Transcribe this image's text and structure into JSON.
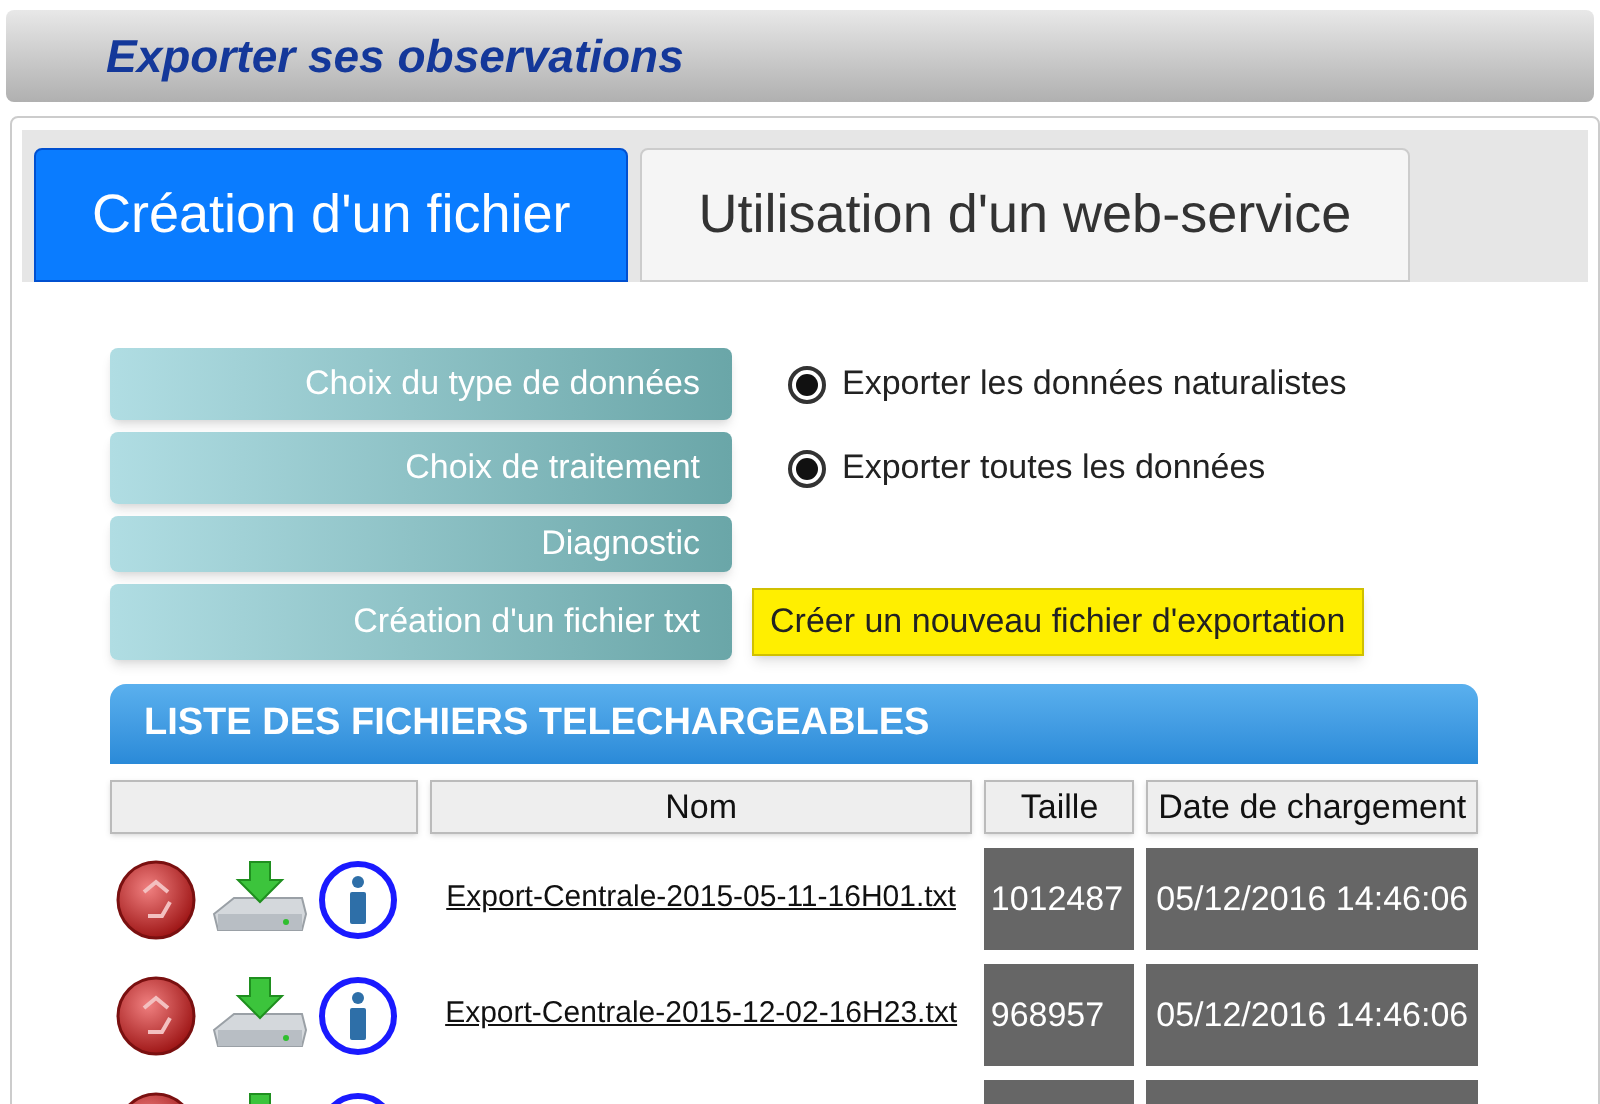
{
  "header": {
    "title": "Exporter ses observations"
  },
  "tabs": [
    {
      "label": "Création d'un fichier",
      "selected": true
    },
    {
      "label": "Utilisation d'un web-service",
      "selected": false
    }
  ],
  "steps": [
    {
      "label": "Choix du type de données",
      "kind": "radio",
      "option": "Exporter les données naturalistes",
      "checked": true
    },
    {
      "label": "Choix de traitement",
      "kind": "radio",
      "option": "Exporter toutes les données",
      "checked": true
    },
    {
      "label": "Diagnostic",
      "kind": "empty"
    },
    {
      "label": "Création d'un fichier txt",
      "kind": "button",
      "option": "Créer un nouveau fichier d'exportation"
    }
  ],
  "files": {
    "title": "LISTE DES FICHIERS TELECHARGEABLES",
    "columns": [
      "Nom",
      "Taille",
      "Date de chargement"
    ],
    "rows": [
      {
        "kind": "full",
        "name": "Export-Centrale-2015-05-11-16H01.txt",
        "size": "1012487",
        "date": "05/12/2016 14:46:06"
      },
      {
        "kind": "full",
        "name": "Export-Centrale-2015-12-02-16H23.txt",
        "size": "968957",
        "date": "05/12/2016 14:46:06"
      },
      {
        "kind": "partial"
      }
    ]
  }
}
